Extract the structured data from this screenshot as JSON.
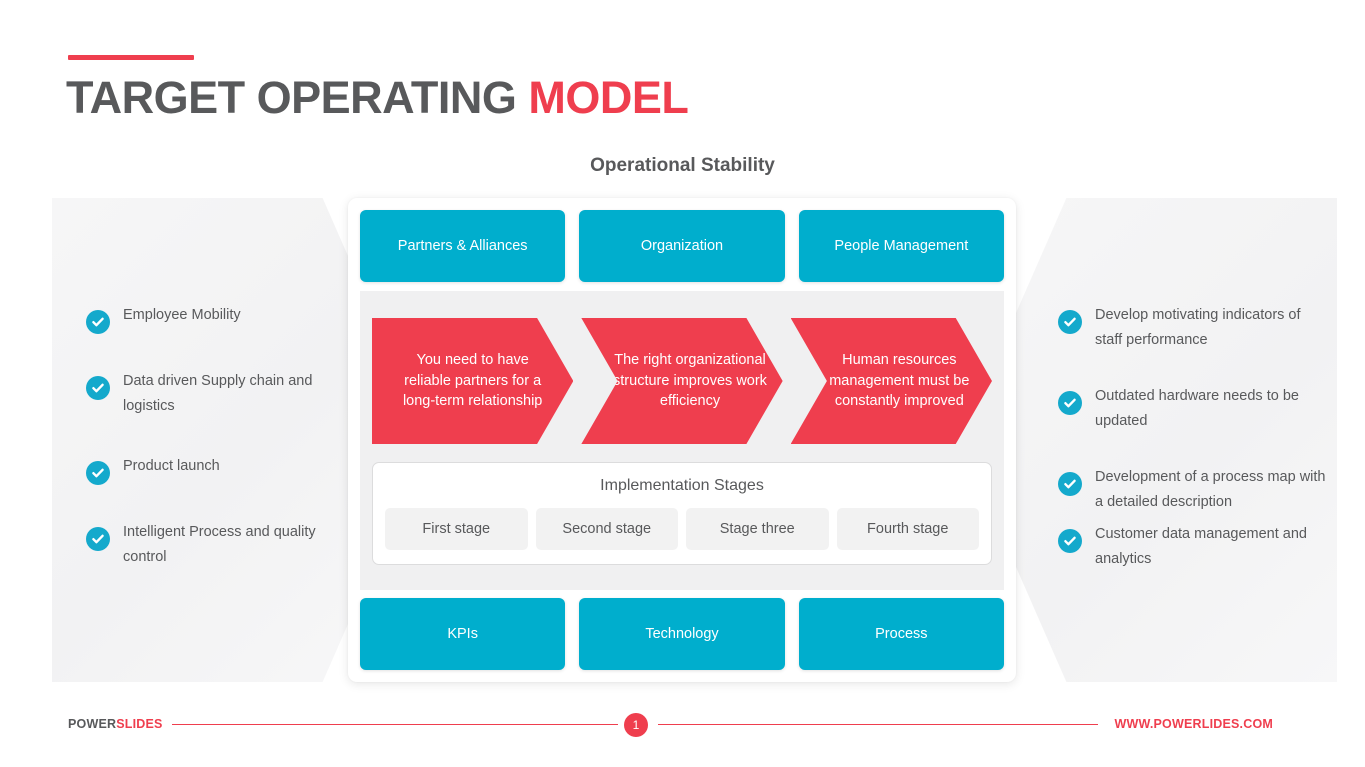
{
  "header": {
    "title_main": "TARGET OPERATING ",
    "title_accent": "MODEL",
    "subtitle": "Operational Stability",
    "accent_color": "#ef3e4e",
    "title_color": "#58595b"
  },
  "colors": {
    "cyan": "#00aecd",
    "red": "#ef3e4e",
    "gray_panel": "#f0f0f1",
    "text": "#58595b"
  },
  "left_list": {
    "items": [
      {
        "label": "Employee Mobility",
        "icon": "check-circle-icon"
      },
      {
        "label": "Data driven Supply chain and logistics",
        "icon": "check-circle-icon"
      },
      {
        "label": "Product launch",
        "icon": "check-circle-icon"
      },
      {
        "label": "Intelligent Process and quality control",
        "icon": "check-circle-icon"
      }
    ]
  },
  "right_list": {
    "items": [
      {
        "label": "Develop motivating indicators of staff performance",
        "icon": "check-circle-icon"
      },
      {
        "label": "Outdated hardware needs to be updated",
        "icon": "check-circle-icon"
      },
      {
        "label": "Development of a process map with a detailed description",
        "icon": "check-circle-icon"
      },
      {
        "label": "Customer data management and analytics",
        "icon": "check-circle-icon"
      }
    ]
  },
  "card": {
    "top_tabs": [
      {
        "label": "Partners & Alliances"
      },
      {
        "label": "Organization"
      },
      {
        "label": "People Management"
      }
    ],
    "chevrons": [
      {
        "label": "You need to have reliable partners for a long-term relationship"
      },
      {
        "label": "The right organizational structure improves work efficiency"
      },
      {
        "label": "Human resources management must be constantly improved"
      }
    ],
    "stages": {
      "title": "Implementation Stages",
      "items": [
        {
          "label": "First stage"
        },
        {
          "label": "Second stage"
        },
        {
          "label": "Stage three"
        },
        {
          "label": "Fourth stage"
        }
      ]
    },
    "bottom_tabs": [
      {
        "label": "KPIs"
      },
      {
        "label": "Technology"
      },
      {
        "label": "Process"
      }
    ]
  },
  "footer": {
    "brand_main": "POWER",
    "brand_accent": "SLIDES",
    "page_number": "1",
    "url": "WWW.POWERLIDES.COM"
  }
}
